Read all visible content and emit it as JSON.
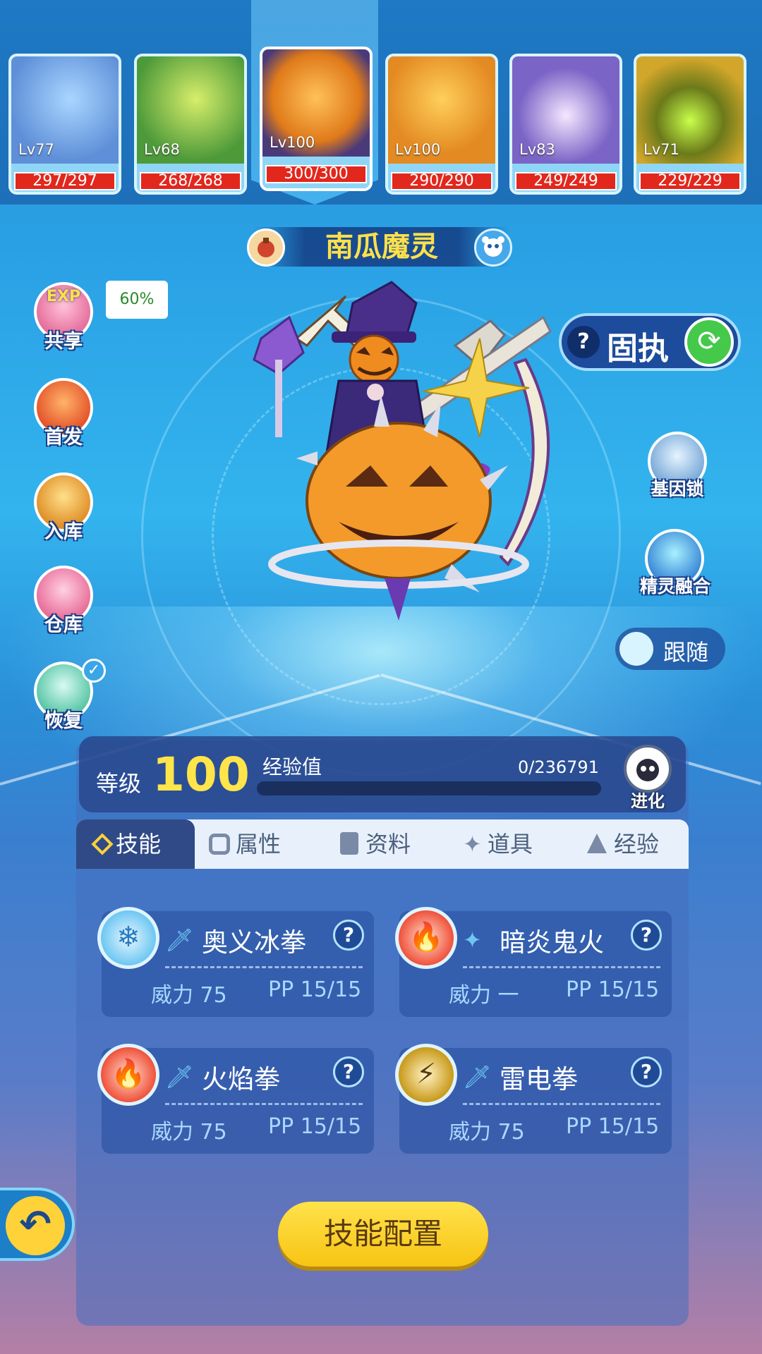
{
  "team": [
    {
      "level": "Lv77",
      "hp": "297/297",
      "color": "#5f8fd8"
    },
    {
      "level": "Lv68",
      "hp": "268/268",
      "color": "#6bb84a"
    },
    {
      "level": "Lv100",
      "hp": "300/300",
      "color": "#f09a2a"
    },
    {
      "level": "Lv100",
      "hp": "290/290",
      "color": "#e38a22"
    },
    {
      "level": "Lv83",
      "hp": "249/249",
      "color": "#7a64c6"
    },
    {
      "level": "Lv71",
      "hp": "229/229",
      "color": "#d2a62a"
    }
  ],
  "pet": {
    "name": "南瓜魔灵",
    "nature": "固执"
  },
  "left_menu": {
    "exp_share": "共享",
    "exp_share_badge": "EXP",
    "exp_share_pct": "60%",
    "first_launch": "首发",
    "store": "入库",
    "warehouse": "仓库",
    "recover": "恢复"
  },
  "right_menu": {
    "gene_lock": "基因锁",
    "fusion": "精灵融合",
    "follow": "跟随"
  },
  "level": {
    "label": "等级",
    "value": "100",
    "exp_label": "经验值",
    "exp_value": "0/236791",
    "exp_progress": 0,
    "evolve": "进化"
  },
  "tabs": [
    "技能",
    "属性",
    "资料",
    "道具",
    "经验"
  ],
  "skills": [
    {
      "name": "奥义冰拳",
      "power": "威力 75",
      "pp": "PP 15/15",
      "color": "#6ec7f2"
    },
    {
      "name": "暗炎鬼火",
      "power": "威力 一",
      "pp": "PP 15/15",
      "color": "#f0523b"
    },
    {
      "name": "火焰拳",
      "power": "威力 75",
      "pp": "PP 15/15",
      "color": "#f0523b"
    },
    {
      "name": "雷电拳",
      "power": "威力 75",
      "pp": "PP 15/15",
      "color": "#c99a1a"
    }
  ],
  "config_button": "技能配置"
}
